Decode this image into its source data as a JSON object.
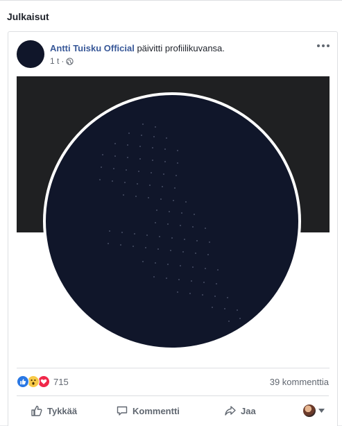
{
  "section": {
    "title": "Julkaisut"
  },
  "post": {
    "author": "Antti Tuisku Official",
    "action": " päivitti profiilikuvansa.",
    "time": "1 t",
    "separator": "·",
    "privacy_icon": "globe-icon",
    "more_icon": "more-icon"
  },
  "reactions": {
    "icons": [
      "like-reaction-icon",
      "wow-reaction-icon",
      "love-reaction-icon"
    ],
    "count": "715",
    "comments": "39 kommenttia"
  },
  "actions": {
    "like": "Tykkää",
    "comment": "Kommentti",
    "share": "Jaa"
  },
  "colors": {
    "link": "#385898",
    "profile_background": "#10162a",
    "cover_background": "#1f2022",
    "like": "#2a78e4",
    "love": "#f0284a",
    "wow": "#f7c948"
  }
}
